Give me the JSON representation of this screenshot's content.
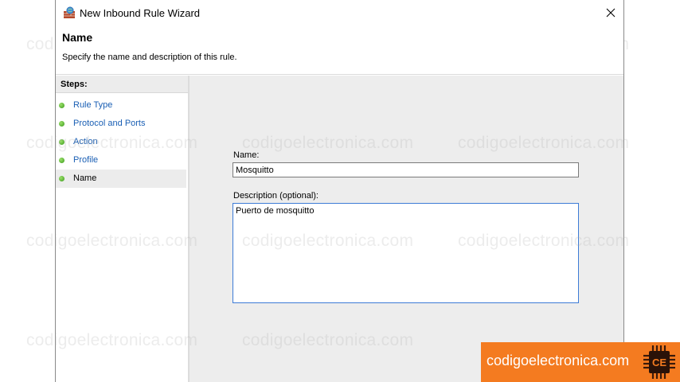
{
  "window": {
    "title": "New Inbound Rule Wizard"
  },
  "header": {
    "title": "Name",
    "subtitle": "Specify the name and description of this rule."
  },
  "steps": {
    "heading": "Steps:",
    "items": [
      {
        "label": "Rule Type"
      },
      {
        "label": "Protocol and Ports"
      },
      {
        "label": "Action"
      },
      {
        "label": "Profile"
      },
      {
        "label": "Name"
      }
    ]
  },
  "form": {
    "name_label": "Name:",
    "name_value": "Mosquitto",
    "description_label": "Description (optional):",
    "description_value": "Puerto de mosquitto"
  },
  "watermark": {
    "text": "codigoelectronica.com"
  },
  "banner": {
    "text": "codigoelectronica.com",
    "logo_text": "CE"
  },
  "colors": {
    "link": "#1a5fb4",
    "banner": "#f47b20",
    "content_bg": "#ededed"
  }
}
